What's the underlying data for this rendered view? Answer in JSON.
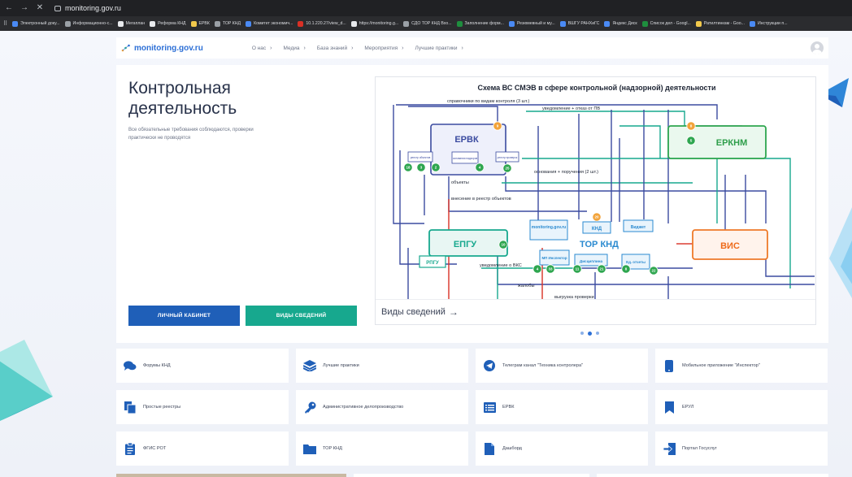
{
  "browser": {
    "url": "monitoring.gov.ru",
    "bookmarks": [
      {
        "label": "Электронный доку...",
        "color": "#4a8af4"
      },
      {
        "label": "Информационно-с...",
        "color": "#9aa0a6"
      },
      {
        "label": "Мегаплан",
        "color": "#e8eaed"
      },
      {
        "label": "Реформа КНД",
        "color": "#e8eaed"
      },
      {
        "label": "ЕРВК",
        "color": "#f2c94c"
      },
      {
        "label": "ТОР КНД",
        "color": "#9aa0a6"
      },
      {
        "label": "Комитет экономич...",
        "color": "#4a8af4"
      },
      {
        "label": "10.1.220.27/view_d...",
        "color": "#d93025"
      },
      {
        "label": "https://monitoring.g...",
        "color": "#e8eaed"
      },
      {
        "label": "СДО ТОР КНД Вхо...",
        "color": "#9aa0a6"
      },
      {
        "label": "Заполнение форм...",
        "color": "#1e8e3e"
      },
      {
        "label": "Резюмевный и му...",
        "color": "#4a8af4"
      },
      {
        "label": "ВШГУ РАНХиГС",
        "color": "#4a8af4"
      },
      {
        "label": "Яндекс Диск",
        "color": "#4a8af4"
      },
      {
        "label": "Список дел - Googl...",
        "color": "#1e8e3e"
      },
      {
        "label": "Ратилтинкам - Goo...",
        "color": "#f2c94c"
      },
      {
        "label": "Инструкции п...",
        "color": "#4a8af4"
      }
    ]
  },
  "header": {
    "logo": "monitoring.gov.ru",
    "nav": [
      "О нас",
      "Медиа",
      "База знаний",
      "Мероприятия",
      "Лучшие практики"
    ]
  },
  "hero": {
    "title_line1": "Контрольная",
    "title_line2": "деятельность",
    "subtitle": "Все обязательные требования соблюдаются, проверки практически не проводятся",
    "btn_cabinet": "ЛИЧНЫЙ КАБИНЕТ",
    "btn_types": "ВИДЫ СВЕДЕНИЙ",
    "caption": "Виды сведений",
    "caption_arrow": "→"
  },
  "scheme": {
    "title": "Схема ВС СМЭВ в сфере контрольной (надзорной) деятельности",
    "top_label": "справочники по видам контроля (3 шт.)",
    "notice_label": "уведомление + отказ от ПВ",
    "basis_label": "основания + поручения (2 шт.)",
    "objects_label": "объекты",
    "registry_label": "внесение в реестр объектов",
    "vks_label": "уведомление о ВКС",
    "complaints_label": "жалобы",
    "extract_label": "выгрузка проверки",
    "nodes": {
      "ervk": "ЕРВК",
      "erknm": "ЕРКНМ",
      "epgu": "ЕПГУ",
      "tor": "ТОР КНД",
      "vis": "ВИС",
      "rpgu": "РПГУ",
      "monitoring": "monitoring.gov.ru",
      "knd": "КНД",
      "widget": "Виджет",
      "mp": "МП Инспектор",
      "discipline": "Дисциплина",
      "reestr1": "реестр объектов",
      "basis": "основания надзоров",
      "reestr2": "реестр проверок",
      "ed": "Ед. отчеты"
    },
    "badges": [
      "9",
      "18",
      "3",
      "2",
      "4",
      "25",
      "8",
      "5",
      "20",
      "10",
      "4",
      "33",
      "11",
      "21",
      "8",
      "22"
    ]
  },
  "pager": {
    "count": 3,
    "active": 2
  },
  "tiles": [
    {
      "label": "Форумы КНД",
      "icon": "chat-icon"
    },
    {
      "label": "Лучшие практики",
      "icon": "layers-icon"
    },
    {
      "label": "Телеграм канал \"Техника контролера\"",
      "icon": "telegram-icon"
    },
    {
      "label": "Мобильное приложение \"Инспектор\"",
      "icon": "phone-icon"
    },
    {
      "label": "Простые реестры",
      "icon": "documents-icon"
    },
    {
      "label": "Административное делопроизводство",
      "icon": "key-icon"
    },
    {
      "label": "ЕРВК",
      "icon": "list-icon"
    },
    {
      "label": "ЕРУЛ",
      "icon": "bookmark-icon"
    },
    {
      "label": "ФГИС РОТ",
      "icon": "clipboard-icon"
    },
    {
      "label": "ТОР КНД",
      "icon": "folder-icon"
    },
    {
      "label": "Дашборд",
      "icon": "file-icon"
    },
    {
      "label": "Портал Госуслуг",
      "icon": "login-icon"
    }
  ],
  "colors": {
    "primary": "#1f5fb8",
    "teal": "#17a88e",
    "link": "#2c6fd6"
  }
}
